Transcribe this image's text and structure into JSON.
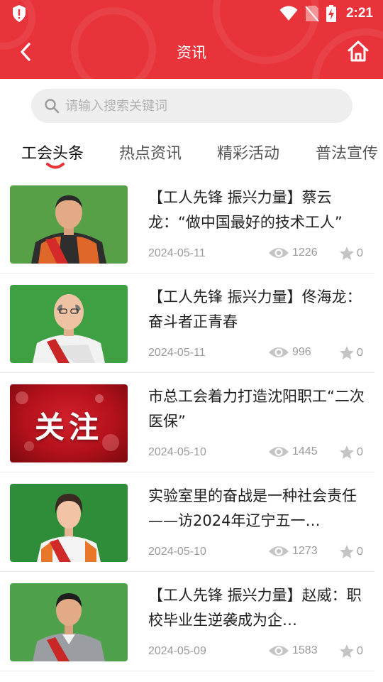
{
  "status_bar": {
    "time": "2:21"
  },
  "header": {
    "title": "资讯"
  },
  "search": {
    "placeholder": "请输入搜索关键词"
  },
  "tabs": [
    {
      "label": "工会头条",
      "active": true
    },
    {
      "label": "热点资讯",
      "active": false
    },
    {
      "label": "精彩活动",
      "active": false
    },
    {
      "label": "普法宣传",
      "active": false
    }
  ],
  "colors": {
    "brand_red": "#e8333b",
    "indicator_red": "#e8333b",
    "meta_gray": "#9a9a9a",
    "icon_gray": "#c4c4c4"
  },
  "news": [
    {
      "title": "【工人先锋 振兴力量】蔡云龙：“做中国最好的技术工人”",
      "date": "2024-05-11",
      "views": "1226",
      "stars": "0",
      "thumb": "portrait-orange-uniform"
    },
    {
      "title": "【工人先锋 振兴力量】佟海龙：奋斗者正青春",
      "date": "2024-05-11",
      "views": "996",
      "stars": "0",
      "thumb": "portrait-white-uniform"
    },
    {
      "title": "市总工会着力打造沈阳职工“二次医保”",
      "date": "2024-05-10",
      "views": "1445",
      "stars": "0",
      "thumb": "关注"
    },
    {
      "title": "实验室里的奋战是一种社会责任——访2024年辽宁五一…",
      "date": "2024-05-10",
      "views": "1273",
      "stars": "0",
      "thumb": "portrait-woman-uniform"
    },
    {
      "title": "【工人先锋 振兴力量】赵威：职校毕业生逆袭成为企…",
      "date": "2024-05-09",
      "views": "1583",
      "stars": "0",
      "thumb": "portrait-gray-uniform"
    }
  ]
}
